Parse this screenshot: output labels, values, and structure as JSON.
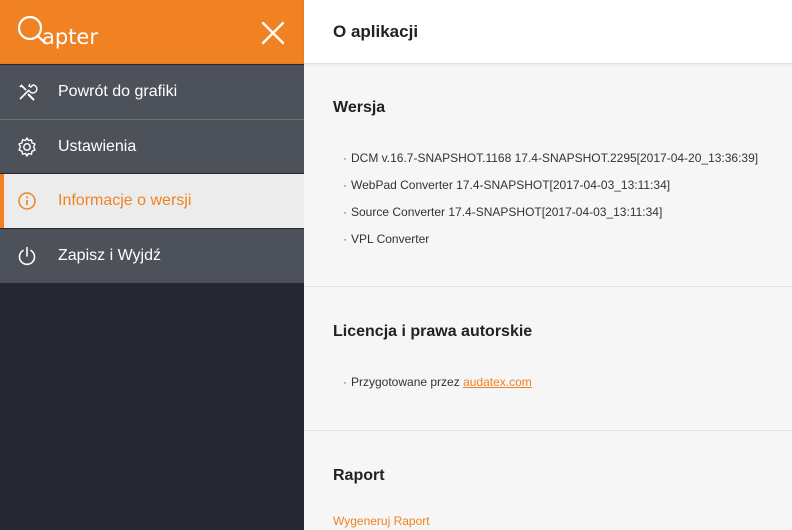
{
  "brand": {
    "logo_text": "apter",
    "accent": "#f08223"
  },
  "sidebar": {
    "items": [
      {
        "label": "Powrót do grafiki",
        "icon": "tools-icon"
      },
      {
        "label": "Ustawienia",
        "icon": "gear-icon"
      },
      {
        "label": "Informacje o wersji",
        "icon": "info-icon",
        "active": true
      },
      {
        "label": "Zapisz i Wyjdź",
        "icon": "power-icon"
      }
    ]
  },
  "main": {
    "title": "O aplikacji",
    "version": {
      "heading": "Wersja",
      "items": [
        "DCM v.16.7-SNAPSHOT.1168 17.4-SNAPSHOT.2295[2017-04-20_13:36:39]",
        "WebPad Converter 17.4-SNAPSHOT[2017-04-03_13:11:34]",
        "Source Converter 17.4-SNAPSHOT[2017-04-03_13:11:34]",
        "VPL Converter"
      ]
    },
    "license": {
      "heading": "Licencja i prawa autorskie",
      "prepared_by": "Przygotowane przez",
      "link": "audatex.com"
    },
    "report": {
      "heading": "Raport",
      "action": "Wygeneruj Raport"
    }
  }
}
